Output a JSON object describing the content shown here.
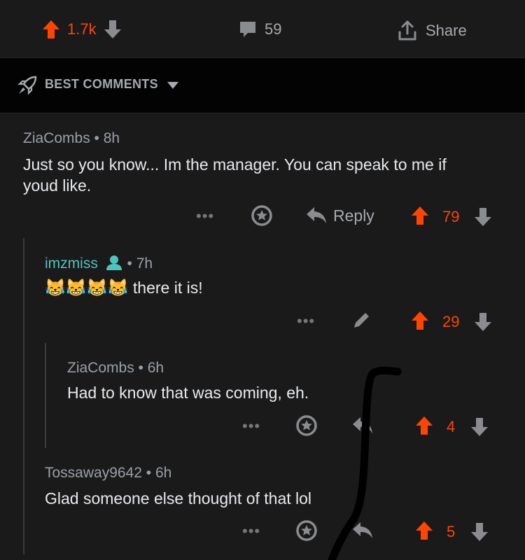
{
  "post_bar": {
    "upvotes": "1.7k",
    "comments": "59",
    "share_label": "Share"
  },
  "sort": {
    "label": "BEST COMMENTS"
  },
  "comments": [
    {
      "user": "ZiaCombs",
      "age": "8h",
      "line1": "Just so you know... Im the manager. You can speak to me if",
      "line2": "youd like.",
      "reply_label": "Reply",
      "score": "79"
    },
    {
      "user": "imzmiss",
      "age": "7h",
      "emoji": "😹😹😹😹",
      "text": "there it is!",
      "score": "29"
    },
    {
      "user": "ZiaCombs",
      "age": "6h",
      "text": "Had to know that was coming, eh.",
      "score": "4"
    },
    {
      "user": "Tossaway9642",
      "age": "6h",
      "text": "Glad someone else thought of that lol",
      "score": "5"
    }
  ],
  "colors": {
    "accent": "#ff4500",
    "mod_green": "#4fc3bd",
    "background": "#1a1a1b"
  }
}
